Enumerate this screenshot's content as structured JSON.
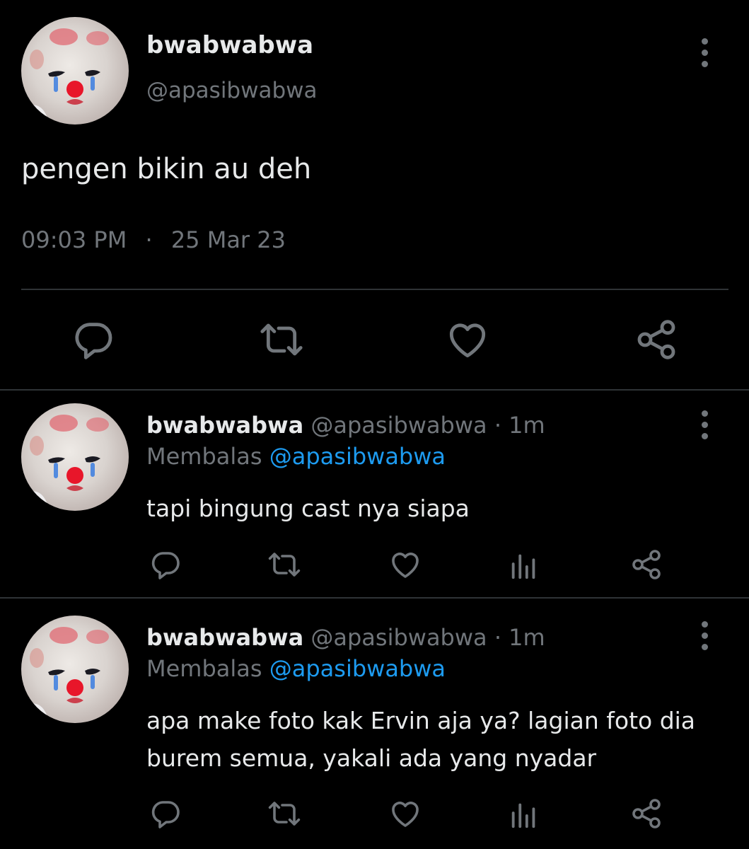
{
  "main_tweet": {
    "display_name": "bwabwabwa",
    "handle": "@apasibwabwa",
    "text": "pengen bikin au deh",
    "time": "09:03 PM",
    "separator": "·",
    "date": "25 Mar 23"
  },
  "replies": [
    {
      "display_name": "bwabwabwa",
      "handle": "@apasibwabwa",
      "separator": "·",
      "age": "1m",
      "replying_label": "Membalas",
      "replying_to": "@apasibwabwa",
      "text_lines": [
        "tapi bingung cast nya siapa"
      ]
    },
    {
      "display_name": "bwabwabwa",
      "handle": "@apasibwabwa",
      "separator": "·",
      "age": "1m",
      "replying_label": "Membalas",
      "replying_to": "@apasibwabwa",
      "text_lines": [
        "apa make foto kak Ervin aja ya? lagian foto dia",
        "burem semua, yakali ada yang nyadar"
      ]
    }
  ],
  "icons": {
    "reply": "reply-icon",
    "retweet": "retweet-icon",
    "like": "heart-icon",
    "views": "views-icon",
    "share": "share-icon",
    "more": "more-vertical-icon"
  },
  "colors": {
    "background": "#000000",
    "text": "#e7e9ea",
    "secondary": "#71767b",
    "accent": "#1d9bf0",
    "divider": "#2f3336"
  }
}
